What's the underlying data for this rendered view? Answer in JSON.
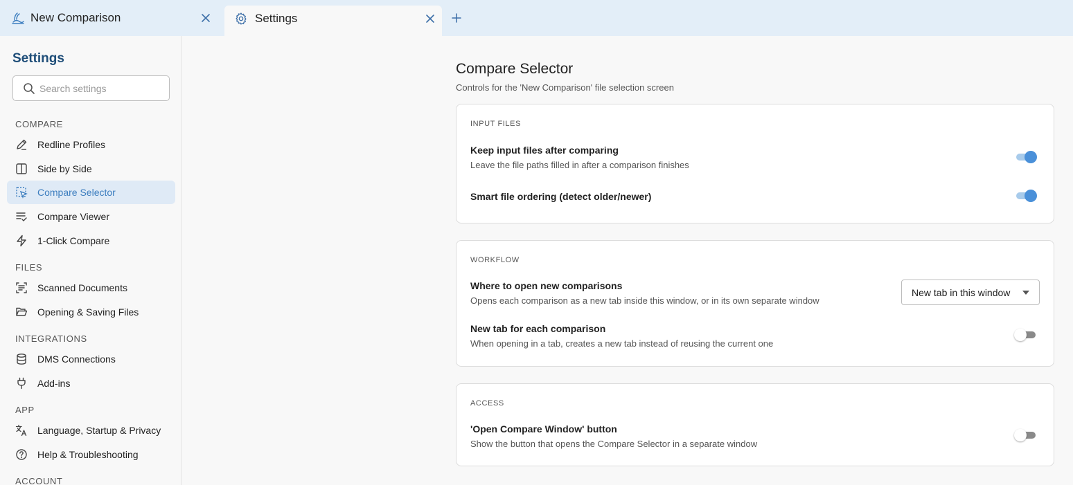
{
  "tabs": [
    {
      "label": "New Comparison",
      "icon": "wave-logo-icon",
      "active": false
    },
    {
      "label": "Settings",
      "icon": "gear-icon",
      "active": true
    }
  ],
  "sidebar": {
    "title": "Settings",
    "search_placeholder": "Search settings",
    "sections": [
      {
        "label": "COMPARE",
        "items": [
          {
            "label": "Redline Profiles",
            "icon": "pencil-icon"
          },
          {
            "label": "Side by Side",
            "icon": "columns-icon"
          },
          {
            "label": "Compare Selector",
            "icon": "selection-cursor-icon",
            "active": true
          },
          {
            "label": "Compare Viewer",
            "icon": "list-check-icon"
          },
          {
            "label": "1-Click Compare",
            "icon": "lightning-icon"
          }
        ]
      },
      {
        "label": "FILES",
        "items": [
          {
            "label": "Scanned Documents",
            "icon": "scan-icon"
          },
          {
            "label": "Opening & Saving Files",
            "icon": "folder-open-icon"
          }
        ]
      },
      {
        "label": "INTEGRATIONS",
        "items": [
          {
            "label": "DMS Connections",
            "icon": "database-icon"
          },
          {
            "label": "Add-ins",
            "icon": "plug-icon"
          }
        ]
      },
      {
        "label": "APP",
        "items": [
          {
            "label": "Language, Startup & Privacy",
            "icon": "translate-icon"
          },
          {
            "label": "Help & Troubleshooting",
            "icon": "help-circle-icon"
          }
        ]
      },
      {
        "label": "ACCOUNT",
        "items": []
      }
    ]
  },
  "main": {
    "title": "Compare Selector",
    "subtitle": "Controls for the 'New Comparison' file selection screen",
    "cards": [
      {
        "header": "INPUT FILES",
        "settings": [
          {
            "title": "Keep input files after comparing",
            "desc": "Leave the file paths filled in after a comparison finishes",
            "control": "toggle",
            "value": true
          },
          {
            "title": "Smart file ordering (detect older/newer)",
            "desc": "",
            "control": "toggle",
            "value": true
          }
        ]
      },
      {
        "header": "WORKFLOW",
        "settings": [
          {
            "title": "Where to open new comparisons",
            "desc": "Opens each comparison as a new tab inside this window, or in its own separate window",
            "control": "dropdown",
            "value": "New tab in this window"
          },
          {
            "title": "New tab for each comparison",
            "desc": "When opening in a tab, creates a new tab instead of reusing the current one",
            "control": "toggle",
            "value": false
          }
        ]
      },
      {
        "header": "ACCESS",
        "settings": [
          {
            "title": "'Open Compare Window' button",
            "desc": "Show the button that opens the Compare Selector in a separate window",
            "control": "toggle",
            "value": false
          }
        ]
      }
    ]
  },
  "colors": {
    "accent": "#4a90d9",
    "sidebar_title": "#1f4e79",
    "tabbar_bg": "#e3eef8",
    "active_nav_bg": "#dfeaf6"
  }
}
